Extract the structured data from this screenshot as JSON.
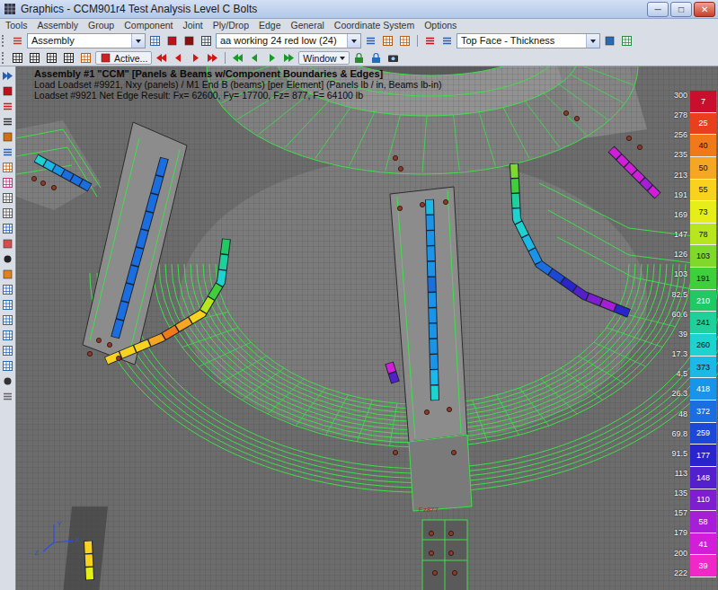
{
  "window": {
    "title": "Graphics - CCM901r4 Test Analysis Level C Bolts",
    "controls": [
      "─",
      "□",
      "✕"
    ]
  },
  "menu": [
    "Tools",
    "Assembly",
    "Group",
    "Component",
    "Joint",
    "Ply/Drop",
    "Edge",
    "General",
    "Coordinate System",
    "Options"
  ],
  "toolbar": {
    "group_select": "Assembly",
    "loadset_select": "aa working 24 red low (24)",
    "result_select": "Top Face - Thickness",
    "active_button": "Active...",
    "window_button": "Window"
  },
  "overlay": [
    "Assembly #1 \"CCM\" [Panels & Beams w/Component Boundaries & Edges]",
    "Load Loadset #9921, Nxy (panels) / M1 End B (beams) [per Element] (Panels lb / in, Beams lb-in)",
    "Loadset #9921 Net Edge Result: Fx= 62600, Fy= 17700, Fz= 877, F= 64100 lb"
  ],
  "marker_label": "Fz877",
  "axes": [
    "Y",
    "X",
    "Z"
  ],
  "legend": {
    "values": [
      "300",
      "278",
      "256",
      "235",
      "213",
      "191",
      "169",
      "147",
      "126",
      "103",
      "82.5",
      "60.6",
      "39",
      "17.3",
      "4.5",
      "26.3",
      "48",
      "69.8",
      "91.5",
      "113",
      "135",
      "157",
      "179",
      "200",
      "222"
    ],
    "bins": [
      {
        "count": "7",
        "color": "#c8102e"
      },
      {
        "count": "25",
        "color": "#e8401c"
      },
      {
        "count": "40",
        "color": "#f07a1a"
      },
      {
        "count": "50",
        "color": "#f5a623"
      },
      {
        "count": "55",
        "color": "#f8d21c"
      },
      {
        "count": "73",
        "color": "#e6ee1a"
      },
      {
        "count": "78",
        "color": "#b8e61e"
      },
      {
        "count": "103",
        "color": "#7fd82a"
      },
      {
        "count": "191",
        "color": "#3ecf3a"
      },
      {
        "count": "210",
        "color": "#22c864"
      },
      {
        "count": "241",
        "color": "#1fd09a"
      },
      {
        "count": "260",
        "color": "#1ed2d0"
      },
      {
        "count": "373",
        "color": "#1cb8e6"
      },
      {
        "count": "418",
        "color": "#1a94e8"
      },
      {
        "count": "372",
        "color": "#1a6ee0"
      },
      {
        "count": "259",
        "color": "#1c48d8"
      },
      {
        "count": "177",
        "color": "#2a24cc"
      },
      {
        "count": "148",
        "color": "#5420cc"
      },
      {
        "count": "110",
        "color": "#7e1ed0"
      },
      {
        "count": "58",
        "color": "#a81ed6"
      },
      {
        "count": "41",
        "color": "#d21ed8"
      },
      {
        "count": "39",
        "color": "#f028c8"
      }
    ]
  },
  "beam_results": [
    {
      "values": [
        27,
        2,
        -23,
        -48,
        -48,
        -48
      ]
    },
    {
      "values": [
        -48,
        -48,
        -40,
        -48,
        -48,
        -48,
        -48,
        -48,
        -48,
        -48
      ]
    },
    {
      "values": [
        76,
        51,
        27,
        101,
        151,
        200,
        225,
        250,
        225,
        200,
        200,
        200
      ]
    },
    {
      "values": [
        2,
        -23,
        -23,
        -23,
        -23,
        -48,
        -23,
        -23,
        -23,
        -23,
        -23,
        2,
        27
      ]
    },
    {
      "values": [
        126,
        101,
        51,
        27,
        27,
        2,
        -23,
        -48,
        -73,
        -98,
        -123,
        -147,
        -172,
        -98
      ]
    },
    {
      "values": [
        -197,
        -197,
        -197,
        -197,
        -172,
        -197
      ]
    },
    {
      "values": [
        -197,
        -123
      ]
    },
    {
      "values": [
        200,
        200,
        176
      ]
    }
  ]
}
